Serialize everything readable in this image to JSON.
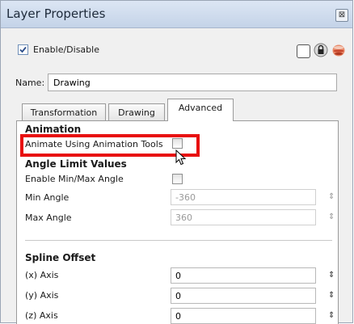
{
  "window": {
    "title": "Layer Properties",
    "close_glyph": "⊠"
  },
  "header": {
    "enable_label": "Enable/Disable",
    "enable_checked": true,
    "icons": [
      "square-icon",
      "lock-icon",
      "onion-skin-icon"
    ]
  },
  "name": {
    "label": "Name:",
    "value": "Drawing"
  },
  "tabs": [
    {
      "label": "Transformation",
      "active": false
    },
    {
      "label": "Drawing",
      "active": false
    },
    {
      "label": "Advanced",
      "active": true
    }
  ],
  "animation": {
    "title": "Animation",
    "animate_label": "Animate Using Animation Tools",
    "animate_checked": false
  },
  "angle_limit": {
    "title": "Angle Limit Values",
    "enable_label": "Enable Min/Max Angle",
    "enable_checked": false,
    "min_label": "Min Angle",
    "min_value": "-360",
    "max_label": "Max Angle",
    "max_value": "360"
  },
  "spline_offset": {
    "title": "Spline Offset",
    "x_label": "(x) Axis",
    "x_value": "0",
    "y_label": "(y) Axis",
    "y_value": "0",
    "z_label": "(z) Axis",
    "z_value": "0"
  },
  "colors": {
    "highlight": "#e81010",
    "titlebar": "#c4d3e8"
  }
}
